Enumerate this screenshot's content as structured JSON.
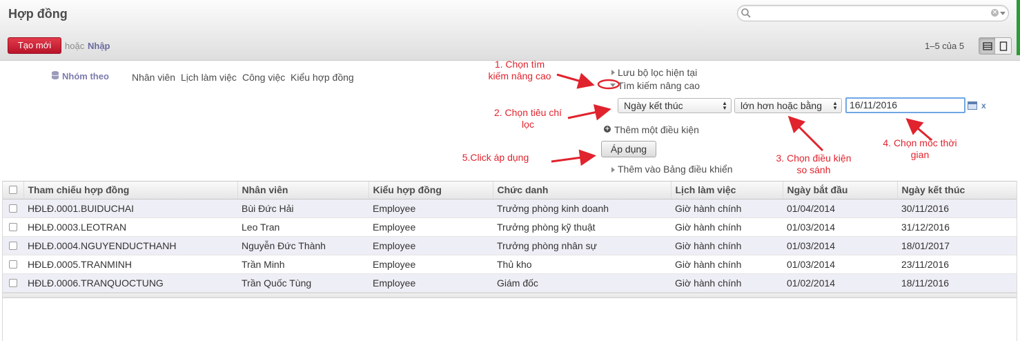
{
  "app": {
    "title": "Hợp đồng"
  },
  "search": {
    "placeholder": ""
  },
  "toolbar": {
    "create_label": "Tạo mới",
    "or_text": "hoặc",
    "import_label": "Nhập",
    "pager_text": "1–5 của 5"
  },
  "group_by": {
    "label": "Nhóm theo",
    "options": [
      "Nhân viên",
      "Lịch làm việc",
      "Công việc",
      "Kiểu hợp đồng"
    ]
  },
  "advanced": {
    "save_filter": "Lưu bộ lọc hiện tại",
    "advanced_search": "Tìm kiếm nâng cao",
    "field_select": "Ngày kết thúc",
    "operator_select": "lớn hơn hoặc bằng",
    "value": "16/11/2016",
    "remove": "x",
    "add_condition": "Thêm một điều kiện",
    "apply": "Áp dụng",
    "add_dashboard": "Thêm vào Bảng điều khiển"
  },
  "annotations": {
    "step1": [
      "1. Chọn tìm",
      "kiếm nâng cao"
    ],
    "step2": [
      "2. Chọn tiêu chí",
      "lọc"
    ],
    "step3": [
      "3. Chọn điều kiện",
      "so sánh"
    ],
    "step4": [
      "4. Chọn mốc thời",
      "gian"
    ],
    "step5": "5.Click áp dụng",
    "color": "#e0232d"
  },
  "table": {
    "columns": [
      "Tham chiếu hợp đồng",
      "Nhân viên",
      "Kiểu hợp đồng",
      "Chức danh",
      "Lịch làm việc",
      "Ngày bắt đầu",
      "Ngày kết thúc"
    ],
    "rows": [
      [
        "HĐLĐ.0001.BUIDUCHAI",
        "Bùi Đức Hải",
        "Employee",
        "Trưởng phòng kinh doanh",
        "Giờ hành chính",
        "01/04/2014",
        "30/11/2016"
      ],
      [
        "HĐLĐ.0003.LEOTRAN",
        "Leo Tran",
        "Employee",
        "Trưởng phòng kỹ thuật",
        "Giờ hành chính",
        "01/03/2014",
        "31/12/2016"
      ],
      [
        "HĐLĐ.0004.NGUYENDUCTHANH",
        "Nguyễn Đức Thành",
        "Employee",
        "Trưởng phòng nhân sự",
        "Giờ hành chính",
        "01/03/2014",
        "18/01/2017"
      ],
      [
        "HĐLĐ.0005.TRANMINH",
        "Trần Minh",
        "Employee",
        "Thủ kho",
        "Giờ hành chính",
        "01/03/2014",
        "23/11/2016"
      ],
      [
        "HĐLĐ.0006.TRANQUOCTUNG",
        "Trần Quốc Tùng",
        "Employee",
        "Giám đốc",
        "Giờ hành chính",
        "01/02/2014",
        "18/11/2016"
      ]
    ]
  },
  "colors": {
    "create_button": "#c71d30",
    "accent_link": "#7c7bad",
    "row_stripe": "#eeeef6",
    "focus_border": "#6fa7e4"
  }
}
